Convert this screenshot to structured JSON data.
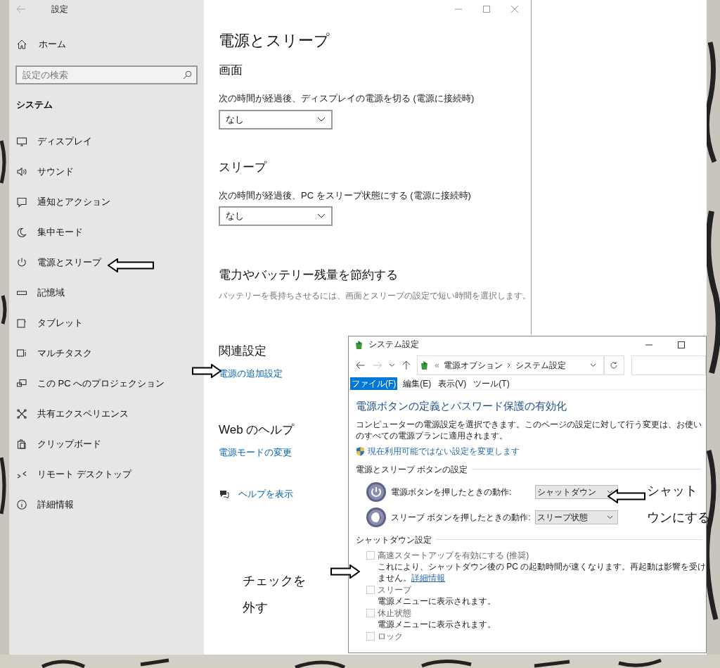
{
  "settings_window": {
    "title": "設定",
    "home": "ホーム",
    "search": {
      "placeholder": "設定の検索"
    },
    "section": "システム",
    "nav": [
      "ディスプレイ",
      "サウンド",
      "通知とアクション",
      "集中モード",
      "電源とスリープ",
      "記憶域",
      "タブレット",
      "マルチタスク",
      "この PC へのプロジェクション",
      "共有エクスペリエンス",
      "クリップボード",
      "リモート デスクトップ",
      "詳細情報"
    ],
    "page": {
      "title": "電源とスリープ",
      "blocks": [
        {
          "kind": "heading",
          "text": "画面"
        },
        {
          "kind": "label",
          "text": "次の時間が経過後、ディスプレイの電源を切る (電源に接続時)"
        },
        {
          "kind": "dropdown",
          "text": "なし"
        },
        {
          "kind": "heading",
          "text": "スリープ"
        },
        {
          "kind": "label",
          "text": "次の時間が経過後、PC をスリープ状態にする (電源に接続時)"
        },
        {
          "kind": "dropdown",
          "text": "なし"
        },
        {
          "kind": "heading",
          "text": "電力やバッテリー残量を節約する"
        },
        {
          "kind": "note",
          "text": "バッテリーを長持ちさせるには、画面とスリープの設定で短い時間を選択します。"
        },
        {
          "kind": "heading",
          "text": "関連設定"
        },
        {
          "kind": "link",
          "text": "電源の追加設定"
        },
        {
          "kind": "heading",
          "text": "Web のヘルプ"
        },
        {
          "kind": "link",
          "text": "電源モードの変更"
        },
        {
          "kind": "help",
          "text": "ヘルプを表示"
        }
      ]
    }
  },
  "control_panel": {
    "title": "システム設定",
    "address_prefix": "«",
    "address": [
      "電源オプション",
      "システム設定"
    ],
    "menu": [
      {
        "label": "ファイル(F)",
        "selected": true
      },
      {
        "label": "編集(E)",
        "selected": false
      },
      {
        "label": "表示(V)",
        "selected": false
      },
      {
        "label": "ツール(T)",
        "selected": false
      }
    ],
    "heading": "電源ボタンの定義とパスワード保護の有効化",
    "description": "コンピューターの電源設定を選択できます。このページの設定に対して行う変更は、お使いのすべての電源プランに適用されます。",
    "admin_link": "現在利用可能ではない設定を変更します",
    "power_section": "電源とスリープ ボタンの設定",
    "actions": [
      {
        "label": "電源ボタンを押したときの動作:",
        "value": "シャットダウン"
      },
      {
        "label": "スリープ ボタンを押したときの動作:",
        "value": "スリープ状態"
      }
    ],
    "shutdown_section": "シャットダウン設定",
    "options": [
      {
        "label": "高速スタートアップを有効にする (推奨)",
        "checked": false,
        "description": "これにより、シャットダウン後の PC の起動時間が速くなります。再起動は影響を受けません。",
        "link": "詳細情報"
      },
      {
        "label": "スリープ",
        "checked": false,
        "description": "電源メニューに表示されます。"
      },
      {
        "label": "休止状態",
        "checked": false,
        "description": "電源メニューに表示されます。"
      },
      {
        "label": "ロック",
        "checked": false
      }
    ]
  },
  "annotations": {
    "notes": [
      {
        "lines": [
          "シャット",
          "ウンにする"
        ]
      },
      {
        "lines": [
          "チェックを",
          "外す"
        ]
      }
    ]
  }
}
